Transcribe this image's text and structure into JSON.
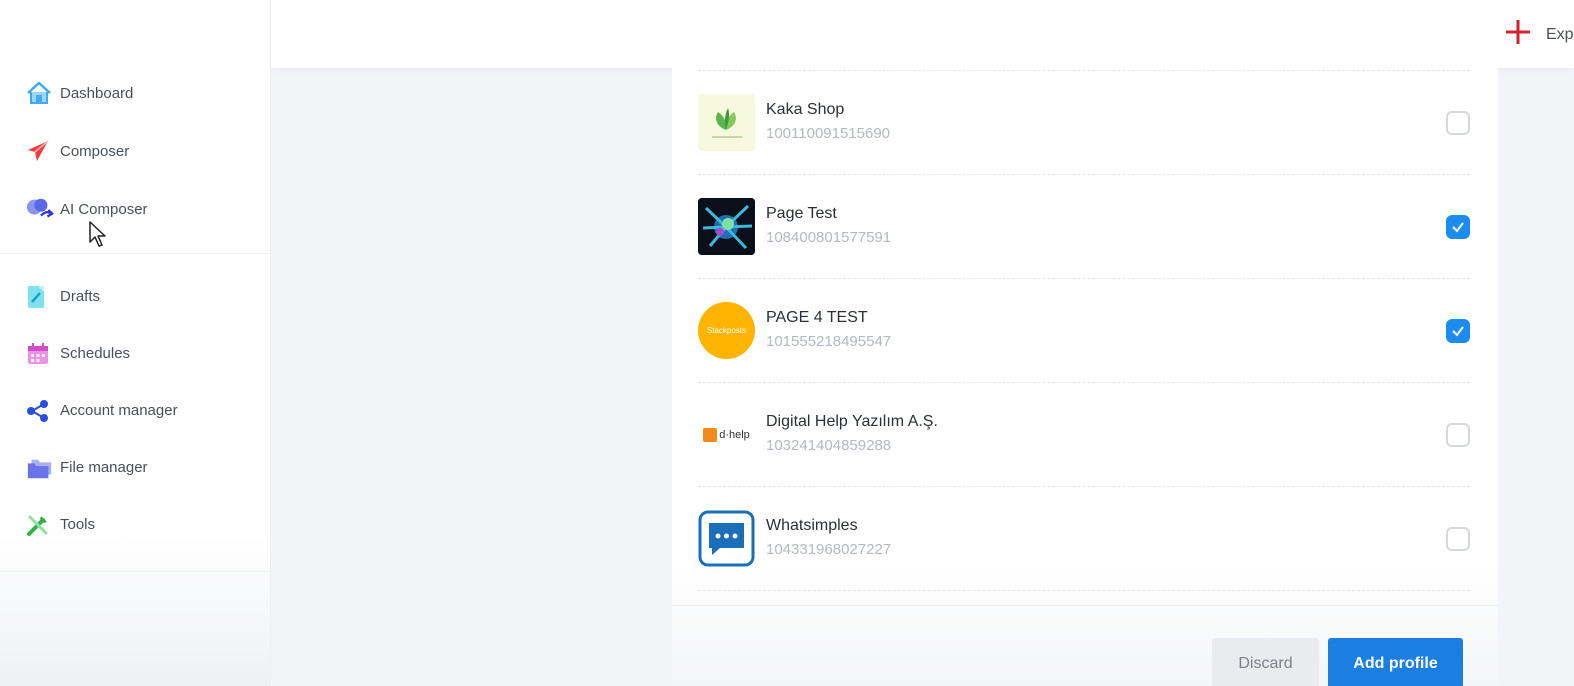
{
  "sidebar": {
    "items": [
      {
        "label": "Dashboard",
        "icon": "home-icon"
      },
      {
        "label": "Composer",
        "icon": "paper-plane-icon"
      },
      {
        "label": "AI Composer",
        "icon": "ai-brain-icon"
      },
      {
        "label": "Drafts",
        "icon": "draft-document-icon"
      },
      {
        "label": "Schedules",
        "icon": "calendar-icon"
      },
      {
        "label": "Account manager",
        "icon": "share-nodes-icon"
      },
      {
        "label": "File manager",
        "icon": "folders-icon"
      },
      {
        "label": "Tools",
        "icon": "tools-icon"
      }
    ]
  },
  "header": {
    "export_label": "Exp"
  },
  "profiles": [
    {
      "name": "Kaka Shop",
      "id": "100110091515690",
      "checked": false,
      "avatar": "leaf-logo"
    },
    {
      "name": "Page Test",
      "id": "108400801577591",
      "checked": true,
      "avatar": "color-splash"
    },
    {
      "name": "PAGE 4 TEST",
      "id": "101555218495547",
      "checked": true,
      "avatar": "yellow-circle",
      "avatar_text": "Stackposts"
    },
    {
      "name": "Digital Help Yazılım A.Ş.",
      "id": "103241404859288",
      "checked": false,
      "avatar": "dhelp-logo",
      "avatar_text": "d·help"
    },
    {
      "name": "Whatsimples",
      "id": "104331968027227",
      "checked": false,
      "avatar": "chat-bubble-logo"
    }
  ],
  "actions": {
    "discard_label": "Discard",
    "add_label": "Add profile"
  },
  "colors": {
    "accent": "#1a7fe0",
    "checkbox_checked": "#1c8cf0",
    "export_plus": "#d2232a"
  }
}
